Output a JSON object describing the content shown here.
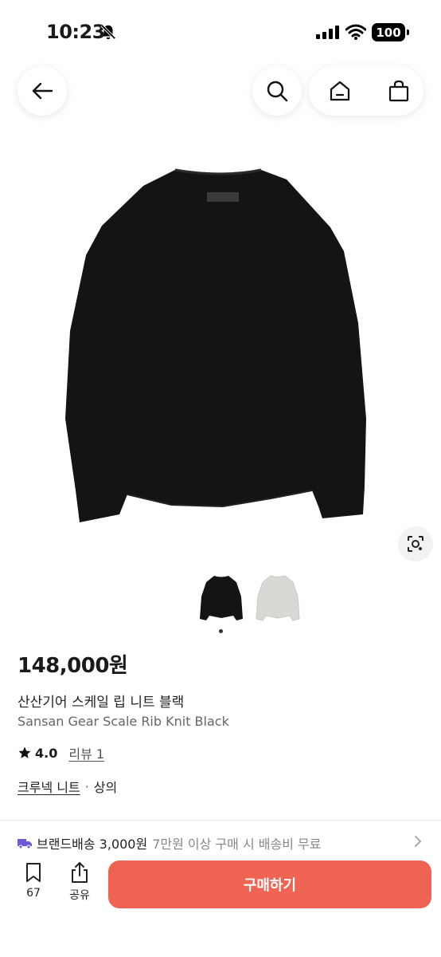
{
  "status_bar": {
    "time": "10:23",
    "battery": "100"
  },
  "header": {
    "back_icon": "arrow-left-icon",
    "search_icon": "search-icon",
    "home_icon": "home-icon",
    "bag_icon": "shopping-bag-icon"
  },
  "product": {
    "price": "148,000원",
    "name_ko": "산산기어 스케일 립 니트 블랙",
    "name_en": "Sansan Gear Scale Rib Knit Black",
    "rating": "4.0",
    "review_label": "리뷰 1",
    "categories": [
      "크루넥 니트",
      "상의"
    ],
    "category_separator": "·",
    "thumbnail_count": 2,
    "colors": {
      "black_sweater": "#141414",
      "gray_sweater": "#d9d8d5"
    }
  },
  "shipping": {
    "label": "브랜드배송 3,000원",
    "note": "7만원 이상 구매 시 배송비 무료"
  },
  "bottom_bar": {
    "bookmark_count": "67",
    "share_label": "공유",
    "buy_label": "구매하기",
    "buy_color": "#ef6352"
  }
}
